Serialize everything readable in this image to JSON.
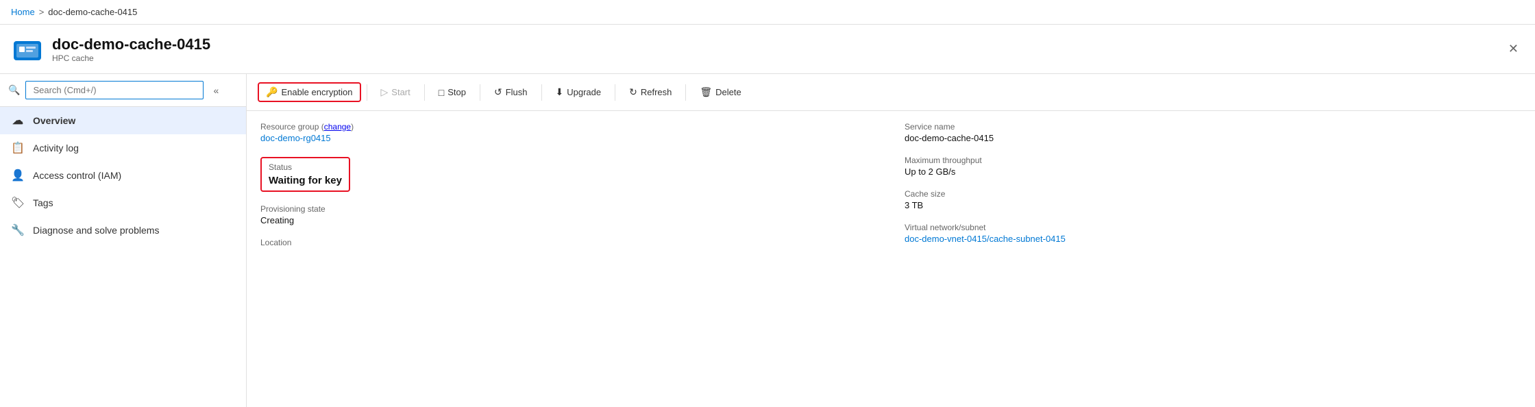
{
  "breadcrumb": {
    "home": "Home",
    "separator": ">",
    "current": "doc-demo-cache-0415"
  },
  "header": {
    "title": "doc-demo-cache-0415",
    "subtitle": "HPC cache",
    "close_label": "✕"
  },
  "sidebar": {
    "search_placeholder": "Search (Cmd+/)",
    "collapse_icon": "«",
    "nav_items": [
      {
        "id": "overview",
        "label": "Overview",
        "icon": "☁",
        "active": true
      },
      {
        "id": "activity-log",
        "label": "Activity log",
        "icon": "📋",
        "active": false
      },
      {
        "id": "access-control",
        "label": "Access control (IAM)",
        "icon": "👤",
        "active": false
      },
      {
        "id": "tags",
        "label": "Tags",
        "icon": "🏷",
        "active": false
      },
      {
        "id": "diagnose",
        "label": "Diagnose and solve problems",
        "icon": "🔧",
        "active": false
      }
    ]
  },
  "toolbar": {
    "buttons": [
      {
        "id": "enable-encryption",
        "label": "Enable encryption",
        "icon": "🔑",
        "highlighted": true,
        "disabled": false
      },
      {
        "id": "start",
        "label": "Start",
        "icon": "▷",
        "highlighted": false,
        "disabled": true
      },
      {
        "id": "stop",
        "label": "Stop",
        "icon": "□",
        "highlighted": false,
        "disabled": false
      },
      {
        "id": "flush",
        "label": "Flush",
        "icon": "↺",
        "highlighted": false,
        "disabled": false
      },
      {
        "id": "upgrade",
        "label": "Upgrade",
        "icon": "⬇",
        "highlighted": false,
        "disabled": false
      },
      {
        "id": "refresh",
        "label": "Refresh",
        "icon": "↻",
        "highlighted": false,
        "disabled": false
      },
      {
        "id": "delete",
        "label": "Delete",
        "icon": "🗑",
        "highlighted": false,
        "disabled": false
      }
    ]
  },
  "details": {
    "left": [
      {
        "id": "resource-group",
        "label": "Resource group",
        "value": "doc-demo-rg0415",
        "link": true,
        "has_change": true
      },
      {
        "id": "status",
        "label": "Status",
        "value": "Waiting for key",
        "highlighted": true
      },
      {
        "id": "provisioning-state",
        "label": "Provisioning state",
        "value": "Creating"
      },
      {
        "id": "location",
        "label": "Location",
        "value": ""
      }
    ],
    "right": [
      {
        "id": "service-name",
        "label": "Service name",
        "value": "doc-demo-cache-0415",
        "link": false
      },
      {
        "id": "max-throughput",
        "label": "Maximum throughput",
        "value": "Up to 2 GB/s",
        "link": false
      },
      {
        "id": "cache-size",
        "label": "Cache size",
        "value": "3 TB",
        "link": false
      },
      {
        "id": "vnet-subnet",
        "label": "Virtual network/subnet",
        "value": "doc-demo-vnet-0415/cache-subnet-0415",
        "link": true
      }
    ],
    "change_label": "change",
    "location_value": ""
  }
}
